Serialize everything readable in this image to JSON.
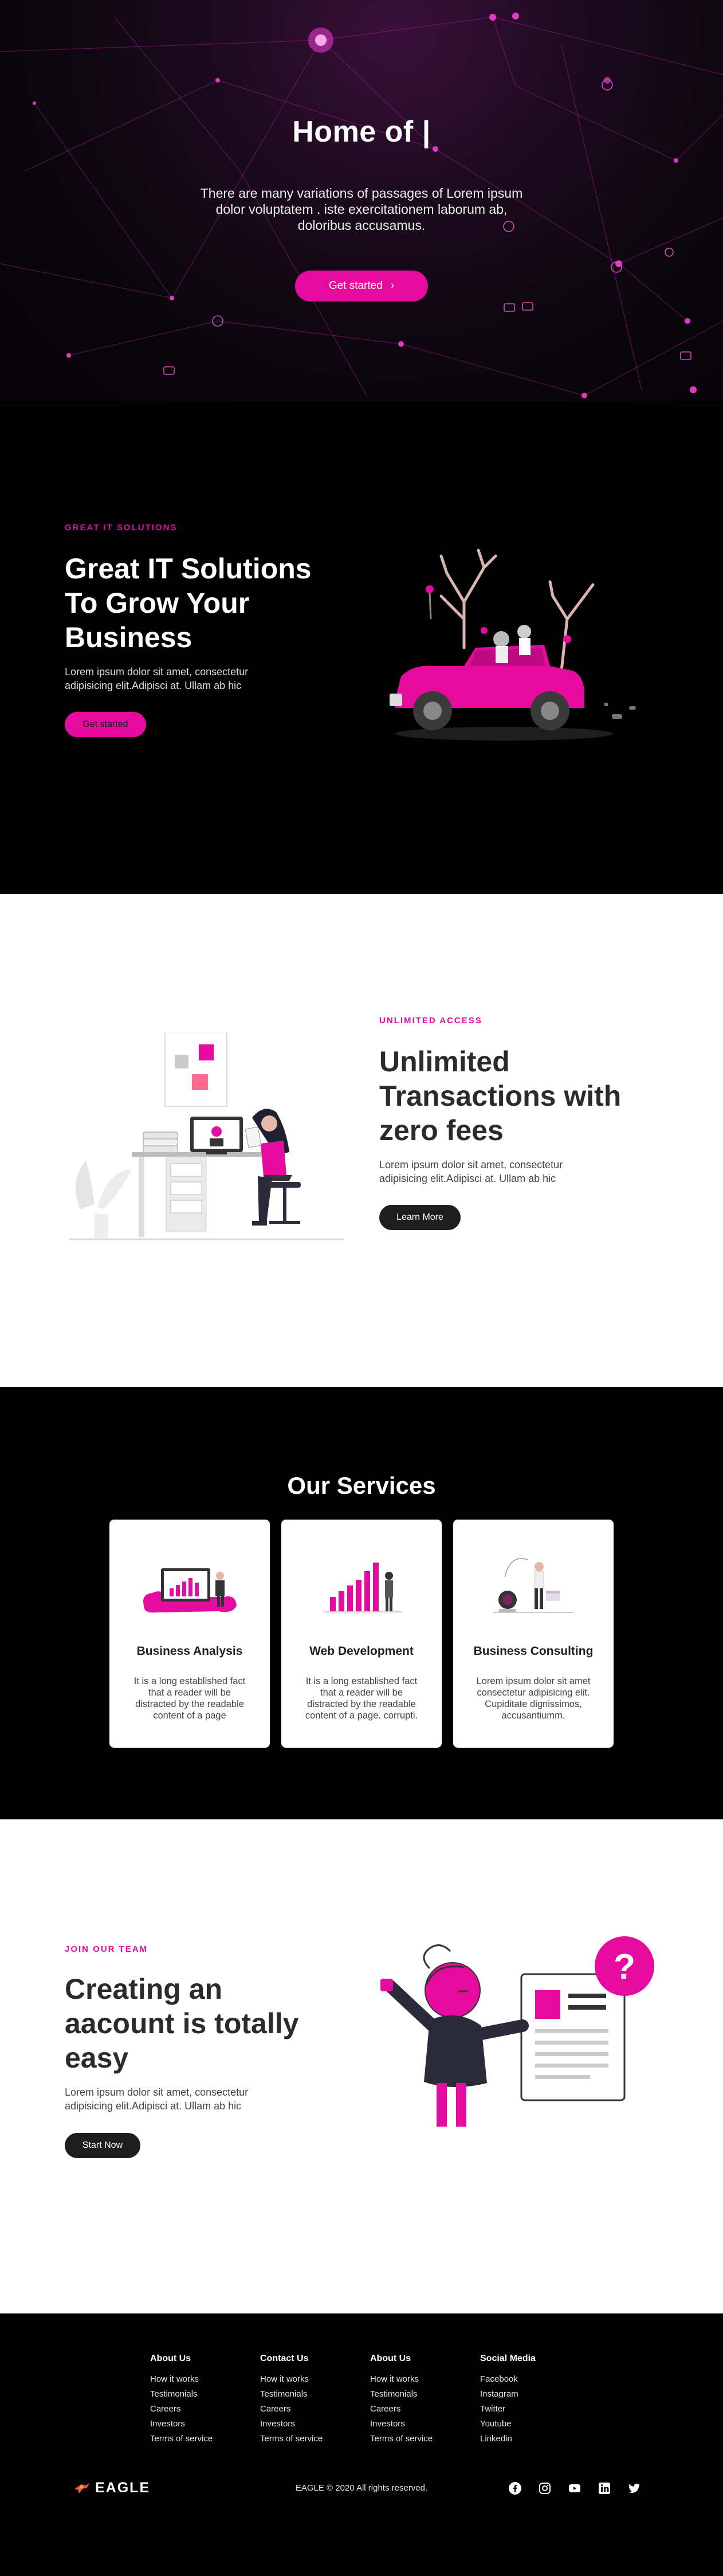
{
  "hero": {
    "title": "Home of |",
    "description": "There are many variations of passages of Lorem ipsum dolor voluptatem . iste exercitationem laborum ab, doloribus accusamus.",
    "button_label": "Get started",
    "button_arrow": "›"
  },
  "solutions": {
    "eyebrow": "GREAT IT SOLUTIONS",
    "title_lines": [
      "Great IT Solutions",
      "To Grow Your",
      "Business"
    ],
    "body": "Lorem ipsum dolor sit amet, consectetur adipisicing elit.Adipisci at. Ullam ab hic",
    "button_label": "Get started"
  },
  "access": {
    "eyebrow": "UNLIMITED ACCESS",
    "title_lines": [
      "Unlimited",
      "Transactions with",
      "zero fees"
    ],
    "body": "Lorem ipsum dolor sit amet, consectetur adipisicing elit.Adipisci at. Ullam ab hic",
    "button_label": "Learn More"
  },
  "services": {
    "title": "Our Services",
    "cards": [
      {
        "title": "Business Analysis",
        "text": "It is a long established fact that a reader will be distracted by the readable content of a page"
      },
      {
        "title": "Web Development",
        "text": "It is a long established fact that a reader will be distracted by the readable content of a page. corrupti."
      },
      {
        "title": "Business Consulting",
        "text": "Lorem ipsum dolor sit amet consectetur adipisicing elit. Cupiditate dignissimos, accusantiumm."
      }
    ]
  },
  "team": {
    "eyebrow": "JOIN OUR TEAM",
    "title_lines": [
      "Creating an",
      "aacount is totally",
      "easy"
    ],
    "body": "Lorem ipsum dolor sit amet, consectetur adipisicing elit.Adipisci at. Ullam ab hic",
    "button_label": "Start Now"
  },
  "footer": {
    "columns": [
      {
        "heading": "About Us",
        "links": [
          "How it works",
          "Testimonials",
          "Careers",
          "Investors",
          "Terms of service"
        ]
      },
      {
        "heading": "Contact Us",
        "links": [
          "How it works",
          "Testimonials",
          "Careers",
          "Investors",
          "Terms of service"
        ]
      },
      {
        "heading": "About Us",
        "links": [
          "How it works",
          "Testimonials",
          "Careers",
          "Investors",
          "Terms of service"
        ]
      },
      {
        "heading": "Social Media",
        "links": [
          "Facebook",
          "Instagram",
          "Twitter",
          "Youtube",
          "Linkedin"
        ]
      }
    ],
    "logo_text": "EAGLE",
    "copyright": "EAGLE © 2020 All rights reserved.",
    "social_icons": [
      "facebook-icon",
      "instagram-icon",
      "youtube-icon",
      "linkedin-icon",
      "twitter-icon"
    ]
  },
  "colors": {
    "accent": "#e60a9e",
    "dark": "#000000",
    "light": "#ffffff",
    "text_dark": "#2b2b2b"
  }
}
